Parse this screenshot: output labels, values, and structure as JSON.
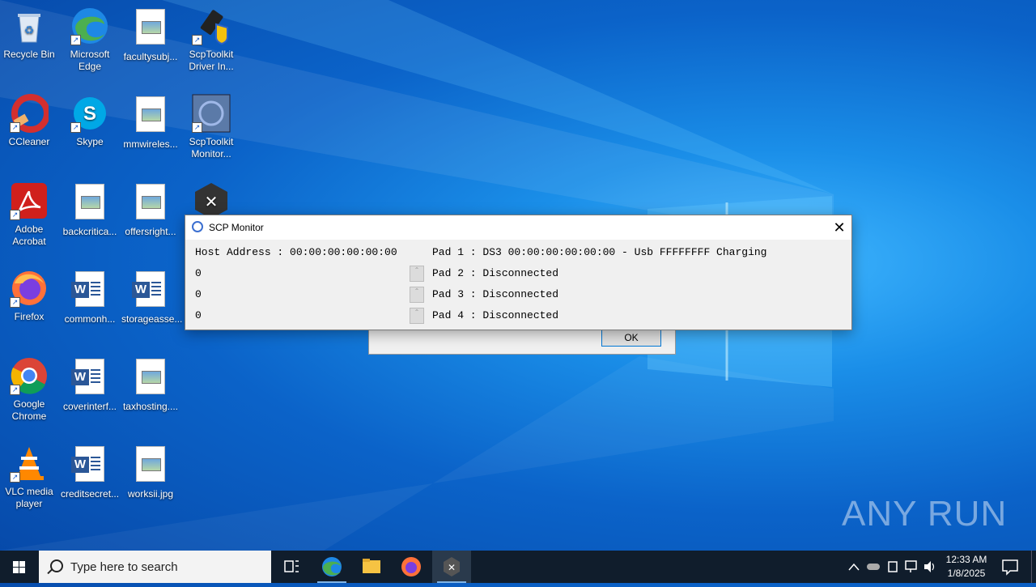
{
  "desktop": {
    "icons": [
      {
        "label": "Recycle Bin"
      },
      {
        "label": "Microsoft Edge"
      },
      {
        "label": "facultysubj..."
      },
      {
        "label": "ScpToolkit Driver In..."
      },
      {
        "label": "CCleaner"
      },
      {
        "label": "Skype"
      },
      {
        "label": "mmwireles..."
      },
      {
        "label": "ScpToolkit Monitor..."
      },
      {
        "label": "Adobe Acrobat"
      },
      {
        "label": "backcritica..."
      },
      {
        "label": "offersright..."
      },
      {
        "label": "Firefox"
      },
      {
        "label": "commonh..."
      },
      {
        "label": "storageasse..."
      },
      {
        "label": "Google Chrome"
      },
      {
        "label": "coverinterf..."
      },
      {
        "label": "taxhosting...."
      },
      {
        "label": "VLC media player"
      },
      {
        "label": "creditsecret..."
      },
      {
        "label": "worksii.jpg"
      }
    ]
  },
  "message_box": {
    "ok_label": "OK"
  },
  "scp_monitor": {
    "title": "SCP Monitor",
    "host_address": "Host Address : 00:00:00:00:00:00",
    "rows": [
      {
        "value": "0",
        "pad": "Pad 1 : DS3 00:00:00:00:00:00 - Usb FFFFFFFF Charging"
      },
      {
        "value": "0",
        "pad": "Pad 2 : Disconnected"
      },
      {
        "value": "0",
        "pad": "Pad 3 : Disconnected"
      },
      {
        "value": "0",
        "pad": "Pad 4 : Disconnected"
      }
    ]
  },
  "watermark": "ANY RUN",
  "taskbar": {
    "search_placeholder": "Type here to search",
    "time": "12:33 AM",
    "date": "1/8/2025"
  }
}
